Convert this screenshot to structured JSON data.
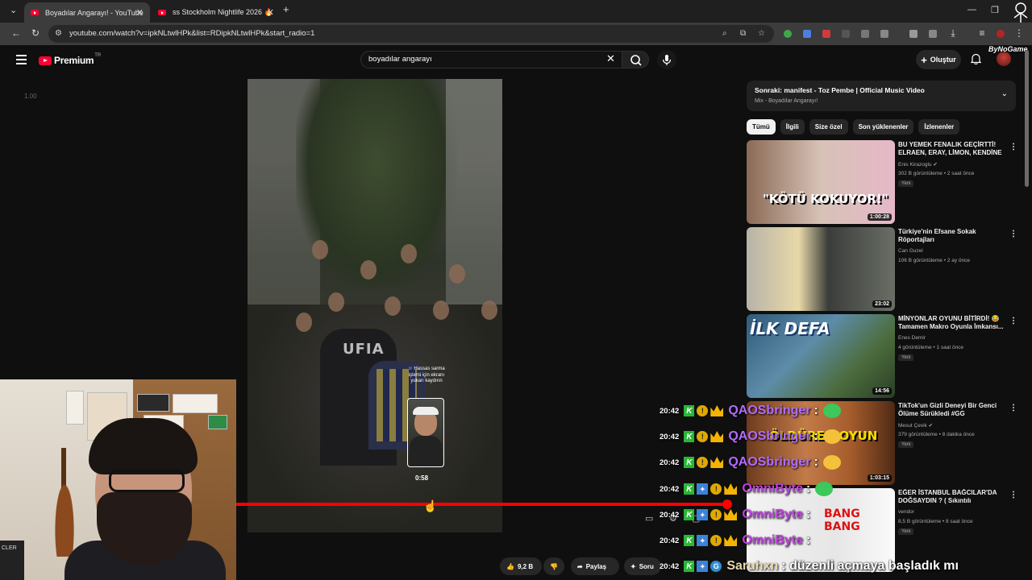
{
  "browser": {
    "tabs": [
      {
        "title": "Boyadılar Angarayı! - YouTube",
        "active": true
      },
      {
        "title": "ss Stockholm Nightlife 2026 🔥",
        "active": false
      }
    ],
    "new_tab": "+",
    "url": "youtube.com/watch?v=ipkNLtwlHPk&list=RDipkNLtwlHPk&start_radio=1",
    "overlay_brand": "ByNoGame"
  },
  "header": {
    "logo": "Premium",
    "logo_sup": "TR",
    "search_value": "boyadılar angarayı",
    "create_label": "Oluştur"
  },
  "player": {
    "speed": "1.00",
    "hint_text": "☆ Hassas sarma işlemi için ekranı yukarı kaydırın",
    "preview_time": "0:58",
    "shirt_text": "UFIA",
    "progress_fraction": 0.995,
    "scrub_fraction": 0.385
  },
  "actions": {
    "like_count": "9,2 B",
    "share_label": "Paylaş",
    "ask_label": "Soru"
  },
  "up_next": {
    "title": "Sonraki: manifest - Toz Pembe | Official Music Video",
    "subtitle": "Mix - Boyadılar Angarayı!"
  },
  "chips": [
    "Tümü",
    "İlgili",
    "Size özel",
    "Son yüklenenler",
    "İzlenenler"
  ],
  "recommendations": [
    {
      "title": "BU YEMEK FENALIK GEÇİRTTİ! ELRAEN, ERAY, LİMON, KENDİNE ...",
      "channel": "Enis Kirazoglu ✔",
      "meta": "302 B görüntüleme • 2 saat önce",
      "badge": "Yeni",
      "duration": "1:00:28",
      "thumb_text": "\"KÖTÜ KOKUYOR!\""
    },
    {
      "title": "Türkiye'nin Efsane Sokak Röportajları",
      "channel": "Can Guzel",
      "meta": "106 B görüntüleme • 2 ay önce",
      "badge": "",
      "duration": "23:02",
      "thumb_text": ""
    },
    {
      "title": "MİNYONLAR OYUNU BİTİRDİ! 😂 Tamamen Makro Oyunla İmkansı...",
      "channel": "Enes Demir",
      "meta": "4 görüntüleme • 1 saat önce",
      "badge": "Yeni",
      "duration": "14:56",
      "thumb_text": "İLK DEFA"
    },
    {
      "title": "TikTok'un Gizli Deneyi Bir Genci Ölüme Sürükledi #GG",
      "channel": "Mesut Çevik ✔",
      "meta": "379 görüntüleme • 8 dakika önce",
      "badge": "Yeni",
      "duration": "1:03:15",
      "thumb_text": "ÖLDÜREN OYUN"
    },
    {
      "title": "EĞER İSTANBUL BAĞCILAR'DA DOĞSAYDIN ? ( Sıkıntılı Mahalleler...",
      "channel": "vendor",
      "meta": "8,5 B görüntüleme • 8 saat önce",
      "badge": "Yeni",
      "duration": "",
      "thumb_text": "BANG BANG"
    }
  ],
  "chat": [
    {
      "time": "20:42",
      "user": "QAOSbringer",
      "msg": ":",
      "color": "#b36bff"
    },
    {
      "time": "20:42",
      "user": "QAOSbringer",
      "msg": ":",
      "color": "#b36bff"
    },
    {
      "time": "20:42",
      "user": "QAOSbringer",
      "msg": ":",
      "color": "#b36bff"
    },
    {
      "time": "20:42",
      "user": "OmniByte",
      "msg": ":",
      "color": "#c040e0"
    },
    {
      "time": "20:42",
      "user": "OmniByte",
      "msg": ":",
      "color": "#c040e0"
    },
    {
      "time": "20:42",
      "user": "OmniByte",
      "msg": ":",
      "color": "#c040e0"
    },
    {
      "time": "20:42",
      "user": "Saruhxn",
      "msg": ": düzenli açmaya başladık mı",
      "color": "#e8d9b0"
    }
  ],
  "webcam": {
    "corner_text": "CLER"
  },
  "colors": {
    "accent": "#ff0000",
    "background": "#0f0f0f"
  }
}
